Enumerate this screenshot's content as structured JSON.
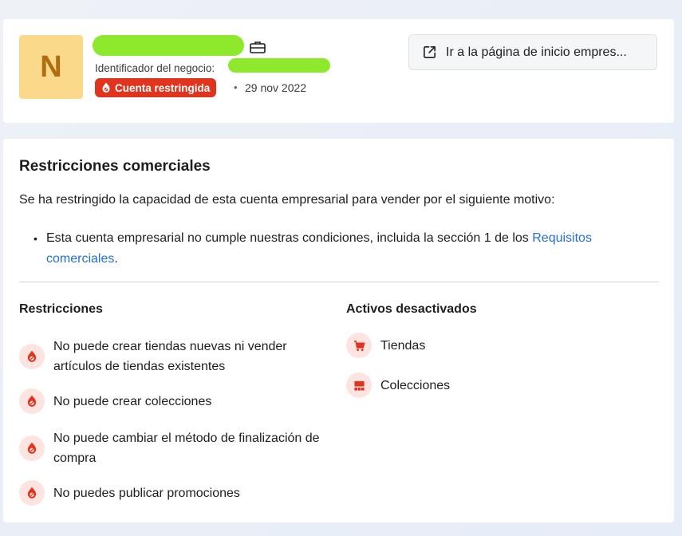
{
  "header": {
    "avatar_letter": "N",
    "business_id_label": "Identificador del negocio:",
    "status_badge": "Cuenta restringida",
    "separator": "•",
    "date": "29 nov 2022",
    "home_button_label": "Ir a la página de inicio empres..."
  },
  "main": {
    "title": "Restricciones comerciales",
    "intro": "Se ha restringido la capacidad de esta cuenta empresarial para vender por el siguiente motivo:",
    "bullet_symbol": "•",
    "reason_text": "Esta cuenta empresarial no cumple nuestras condiciones, incluida la sección 1 de los ",
    "reason_link": "Requisitos comerciales",
    "reason_end": "."
  },
  "restrictions": {
    "title": "Restricciones",
    "items": [
      "No puede crear tiendas nuevas ni vender artículos de tiendas existentes",
      "No puede crear colecciones",
      "No puede cambiar el método de finalización de compra",
      "No puedes publicar promociones"
    ]
  },
  "disabled_assets": {
    "title": "Activos desactivados",
    "items": [
      "Tiendas",
      "Colecciones"
    ]
  },
  "colors": {
    "accent_red": "#e1341e",
    "icon_bg": "#fde4e0",
    "link_blue": "#216fdb",
    "avatar_bg": "#fbd98a",
    "avatar_fg": "#b06d0f"
  },
  "icons": {
    "restriction": "restriction-icon",
    "shop": "cart-icon",
    "collection": "collection-icon",
    "external": "external-link-icon",
    "briefcase": "briefcase-icon"
  }
}
